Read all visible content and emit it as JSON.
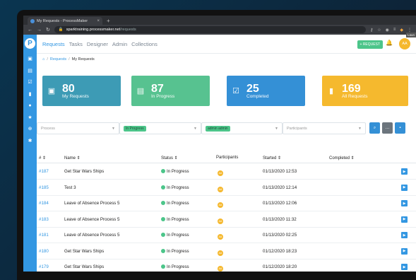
{
  "browser": {
    "tab_title": "My Requests - ProcessMaker",
    "tab_close": "×",
    "new_tab": "+",
    "url_host": "sparktraining.processmaker.net",
    "url_path": "/requests",
    "launch_tip": "Laun"
  },
  "nav": {
    "items": [
      "Requests",
      "Tasks",
      "Designer",
      "Admin",
      "Collections"
    ],
    "request_button": "+ REQUEST",
    "avatar_initials": "AA"
  },
  "breadcrumb": {
    "home": "⌂",
    "requests": "Requests",
    "current": "My Requests"
  },
  "cards": [
    {
      "num": "80",
      "label": "My Requests",
      "color": "#3d9bb5"
    },
    {
      "num": "87",
      "label": "In Progress",
      "color": "#57c290"
    },
    {
      "num": "25",
      "label": "Completed",
      "color": "#3490d6"
    },
    {
      "num": "169",
      "label": "All Requests",
      "color": "#f5b92e"
    }
  ],
  "filters": {
    "process_placeholder": "Process",
    "status_chip": "In Progress",
    "requester_chip": "admin admin",
    "participants_placeholder": "Participants"
  },
  "table": {
    "headers": [
      "# ⇕",
      "Name ⇕",
      "Status ⇕",
      "Participants",
      "Started ⇕",
      "Completed ⇕"
    ],
    "rows": [
      {
        "id": "#187",
        "name": "Get Star Wars Ships",
        "status": "In Progress",
        "started": "01/13/2020 12:53"
      },
      {
        "id": "#185",
        "name": "Test 3",
        "status": "In Progress",
        "started": "01/13/2020 12:14"
      },
      {
        "id": "#184",
        "name": "Leave of Absence Process 5",
        "status": "In Progress",
        "started": "01/13/2020 12:06"
      },
      {
        "id": "#183",
        "name": "Leave of Absence Process 5",
        "status": "In Progress",
        "started": "01/13/2020 11:32"
      },
      {
        "id": "#181",
        "name": "Leave of Absence Process 5",
        "status": "In Progress",
        "started": "01/13/2020 02:25"
      },
      {
        "id": "#180",
        "name": "Get Star Wars Ships",
        "status": "In Progress",
        "started": "01/12/2020 18:23"
      },
      {
        "id": "#179",
        "name": "Get Star Wars Ships",
        "status": "In Progress",
        "started": "01/12/2020 18:20"
      },
      {
        "id": "#178",
        "name": "Get Star Wars Ships",
        "status": "In Progress",
        "started": "01/12/2020 18:19"
      }
    ]
  }
}
